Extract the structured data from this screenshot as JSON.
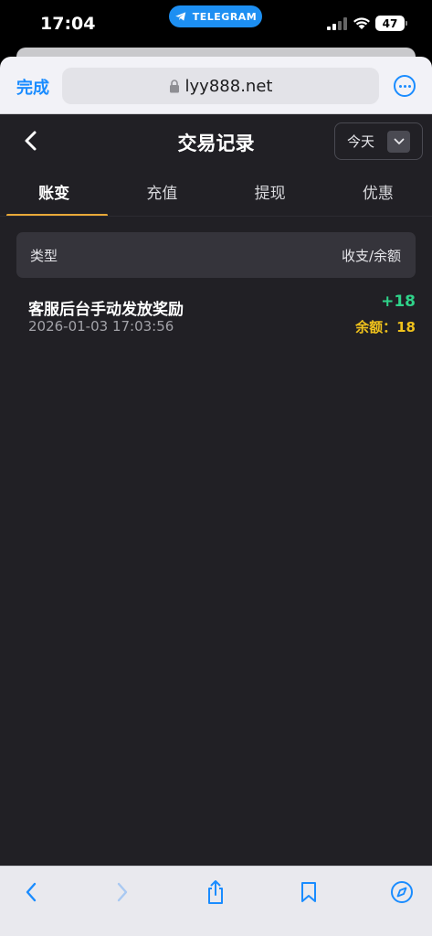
{
  "status_bar": {
    "time": "17:04",
    "app_return_label": "TELEGRAM",
    "battery": "47"
  },
  "browser": {
    "done_label": "完成",
    "url": "lyy888.net"
  },
  "page": {
    "title": "交易记录",
    "date_filter": "今天",
    "tabs": [
      {
        "label": "账变",
        "active": true
      },
      {
        "label": "充值",
        "active": false
      },
      {
        "label": "提现",
        "active": false
      },
      {
        "label": "优惠",
        "active": false
      }
    ],
    "table_header": {
      "type_label": "类型",
      "amount_label": "收支/余额"
    },
    "records": [
      {
        "title": "客服后台手动发放奖励",
        "time": "2026-01-03 17:03:56",
        "amount": "+18",
        "balance": "余额：18"
      }
    ]
  },
  "colors": {
    "background": "#212025",
    "accent_tab": "#e8a938",
    "income": "#2fd38a",
    "balance": "#f0c21c",
    "ios_blue": "#1a8cff"
  }
}
